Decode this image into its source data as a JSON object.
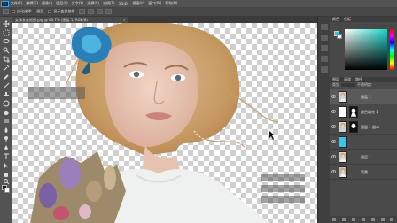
{
  "menubar": {
    "logo": "Ps",
    "items": [
      "文件(F)",
      "编辑(E)",
      "图像(I)",
      "图层(L)",
      "文字(Y)",
      "选择(S)",
      "滤镜(T)",
      "3D(D)",
      "视图(V)",
      "窗口(W)",
      "帮助(H)"
    ]
  },
  "options": {
    "auto_select_label": "自动选择:",
    "target": "图层",
    "show_transform_label": "显示变换控件"
  },
  "document": {
    "tab_title": "女孩发丝抠图.jpg @ 66.7% (图层 1, RGB/8) *",
    "close": "×",
    "zoom": "66.67%"
  },
  "color_panel": {
    "tabs": [
      "颜色",
      "色板"
    ],
    "foreground": "#31c7ee",
    "background": "#ffffff"
  },
  "layers_panel": {
    "tabs": [
      "图层",
      "通道",
      "路径"
    ],
    "kind_label": "类型",
    "opacity_label": "不透明度:",
    "layers": [
      {
        "name": "图层 1",
        "thumb": "portrait",
        "mask": false
      },
      {
        "name": "颜色填充 1",
        "thumb": "fill",
        "mask": true
      },
      {
        "name": "图层 1 副本",
        "thumb": "portrait-cut",
        "mask": true
      },
      {
        "name": "",
        "thumb": "cyan",
        "mask": false
      },
      {
        "name": "图层 1",
        "thumb": "portrait",
        "mask": false
      },
      {
        "name": "背景",
        "thumb": "portrait",
        "mask": false
      }
    ]
  }
}
